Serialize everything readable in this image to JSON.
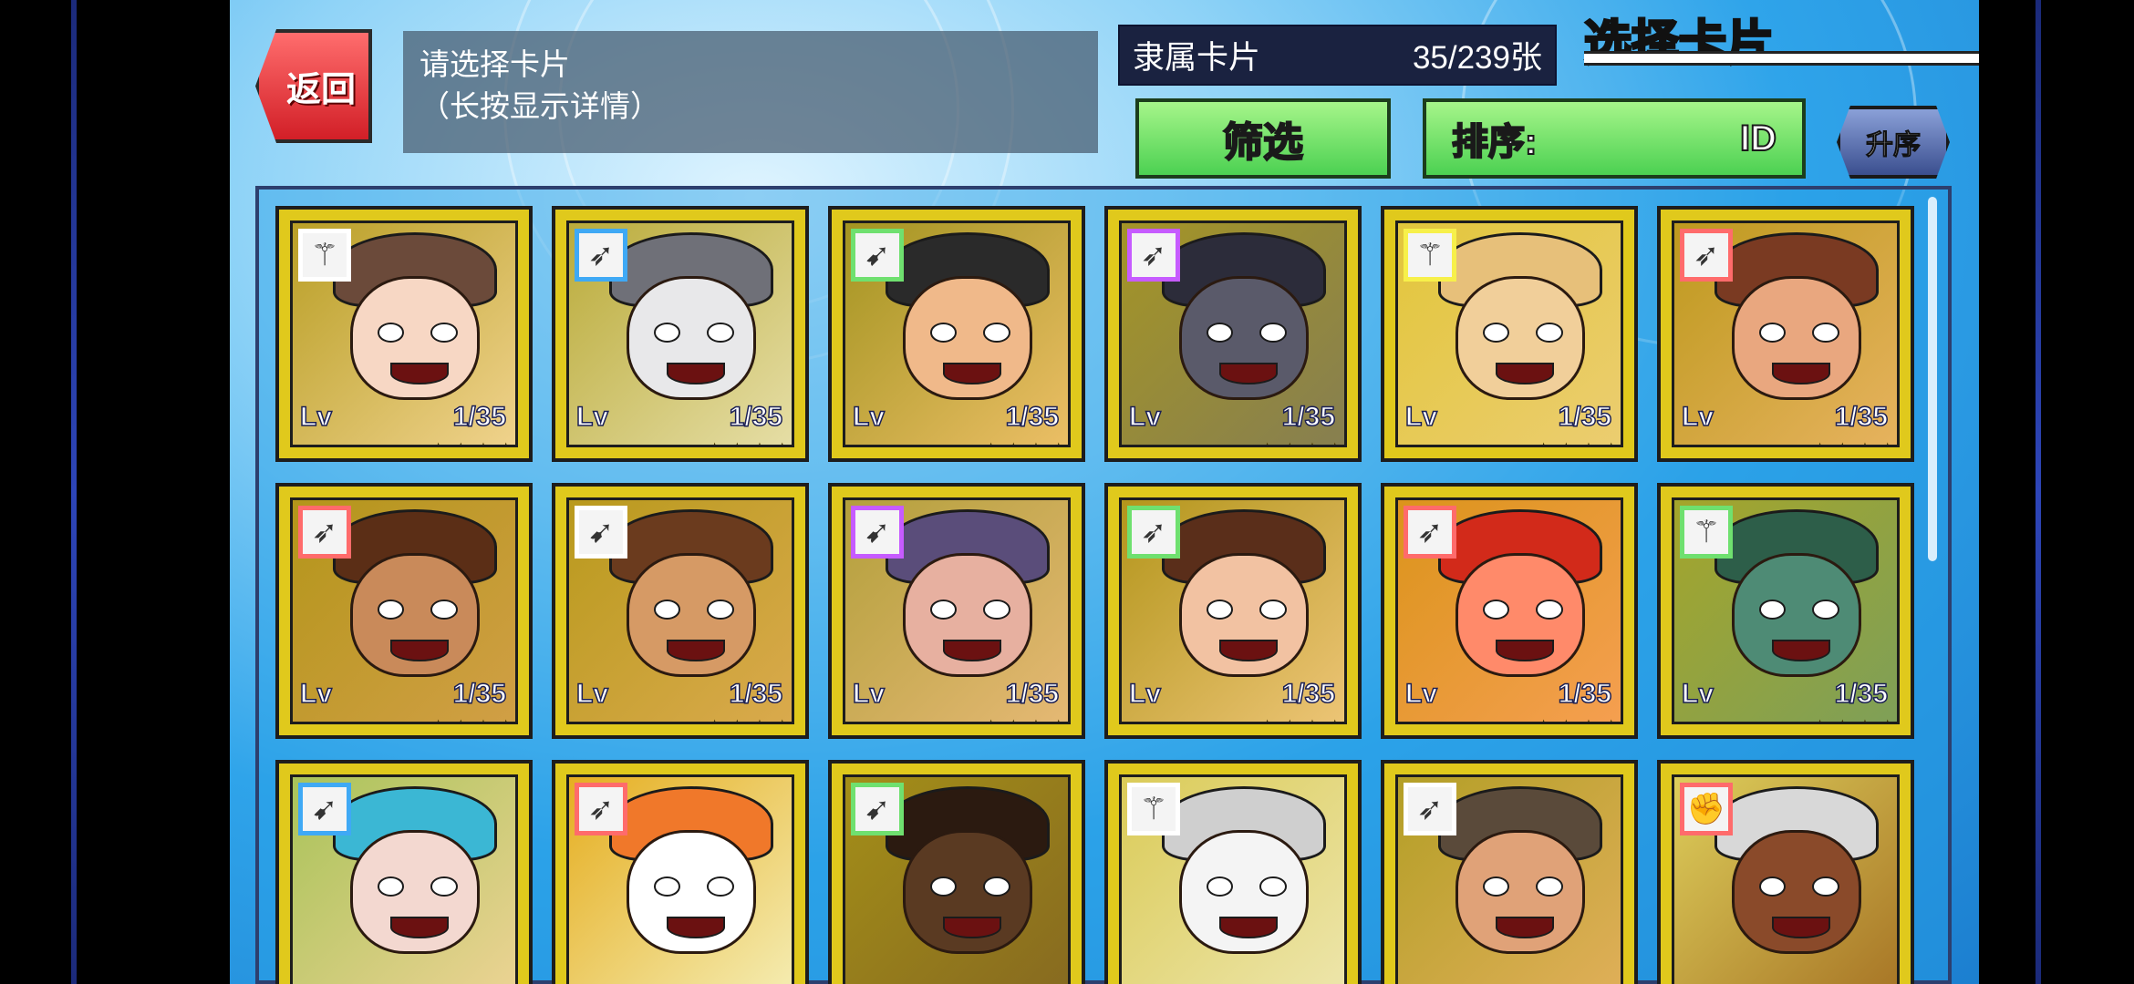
{
  "header": {
    "back_label": "返回",
    "prompt_line1": "请选择卡片",
    "prompt_line2": "（长按显示详情）",
    "count_label": "隶属卡片",
    "count_value": "35/239张",
    "screen_title": "选择卡片"
  },
  "controls": {
    "filter_label": "筛选",
    "sort_label": "排序:",
    "sort_value": "ID",
    "order_label": "升序"
  },
  "cards": [
    {
      "lv_label": "Lv",
      "level": "1/35",
      "stars": "★★★★",
      "weapon": "staff-icon",
      "badge": "#ffffff",
      "skin": "#f7d7c4",
      "hair": "#6b4a3a"
    },
    {
      "lv_label": "Lv",
      "level": "1/35",
      "stars": "★★★★",
      "weapon": "spear-icon",
      "badge": "#3fa9f5",
      "skin": "#e8e8ea",
      "hair": "#6f7078"
    },
    {
      "lv_label": "Lv",
      "level": "1/35",
      "stars": "★★★★",
      "weapon": "bow-icon",
      "badge": "#6fe06f",
      "skin": "#f0b98a",
      "hair": "#2a2a2a"
    },
    {
      "lv_label": "Lv",
      "level": "1/35",
      "stars": "★★★★",
      "weapon": "spear-icon",
      "badge": "#c65bff",
      "skin": "#5a5a6a",
      "hair": "#2c2c3a"
    },
    {
      "lv_label": "Lv",
      "level": "1/35",
      "stars": "★★★★",
      "weapon": "staff-icon",
      "badge": "#f7f04a",
      "skin": "#f1cf9a",
      "hair": "#e7c07a"
    },
    {
      "lv_label": "Lv",
      "level": "1/35",
      "stars": "★★★★",
      "weapon": "spear-icon",
      "badge": "#ff6b6b",
      "skin": "#e9a77f",
      "hair": "#7a3a22"
    },
    {
      "lv_label": "Lv",
      "level": "1/35",
      "stars": "★★★★",
      "weapon": "spear-icon",
      "badge": "#ff6b6b",
      "skin": "#c98a5a",
      "hair": "#5b2e16"
    },
    {
      "lv_label": "Lv",
      "level": "1/35",
      "stars": "★★★★",
      "weapon": "bow-icon",
      "badge": "#ffffff",
      "skin": "#d69a65",
      "hair": "#6b3b1e"
    },
    {
      "lv_label": "Lv",
      "level": "1/35",
      "stars": "★★★★",
      "weapon": "bow-icon",
      "badge": "#c65bff",
      "skin": "#e7b0a0",
      "hair": "#5a4d7a"
    },
    {
      "lv_label": "Lv",
      "level": "1/35",
      "stars": "★★★★",
      "weapon": "spear-icon",
      "badge": "#6fe06f",
      "skin": "#f2c2a2",
      "hair": "#5a2e1a"
    },
    {
      "lv_label": "Lv",
      "level": "1/35",
      "stars": "★★★★",
      "weapon": "spear-icon",
      "badge": "#ff6b6b",
      "skin": "#ff8a6a",
      "hair": "#d22a1a"
    },
    {
      "lv_label": "Lv",
      "level": "1/35",
      "stars": "★★★★",
      "weapon": "staff-icon",
      "badge": "#6fe06f",
      "skin": "#4e8b75",
      "hair": "#2d5e49"
    },
    {
      "lv_label": "",
      "level": "",
      "stars": "",
      "weapon": "bow-icon",
      "badge": "#3fa9f5",
      "skin": "#f3d8d0",
      "hair": "#3bb7d4"
    },
    {
      "lv_label": "",
      "level": "",
      "stars": "",
      "weapon": "spear-icon",
      "badge": "#ff6b6b",
      "skin": "#ffffff",
      "hair": "#f0782a"
    },
    {
      "lv_label": "",
      "level": "",
      "stars": "",
      "weapon": "bow-icon",
      "badge": "#6fe06f",
      "skin": "#5a3a22",
      "hair": "#2b1a10"
    },
    {
      "lv_label": "",
      "level": "",
      "stars": "",
      "weapon": "staff-icon",
      "badge": "#ffffff",
      "skin": "#f4f4f4",
      "hair": "#cfcfcf"
    },
    {
      "lv_label": "",
      "level": "",
      "stars": "",
      "weapon": "spear-icon",
      "badge": "#ffffff",
      "skin": "#e0a278",
      "hair": "#5a4a3a"
    },
    {
      "lv_label": "",
      "level": "",
      "stars": "",
      "weapon": "gauntlet-icon",
      "badge": "#ff6b6b",
      "skin": "#8a4a2a",
      "hair": "#d8d8d8"
    }
  ]
}
